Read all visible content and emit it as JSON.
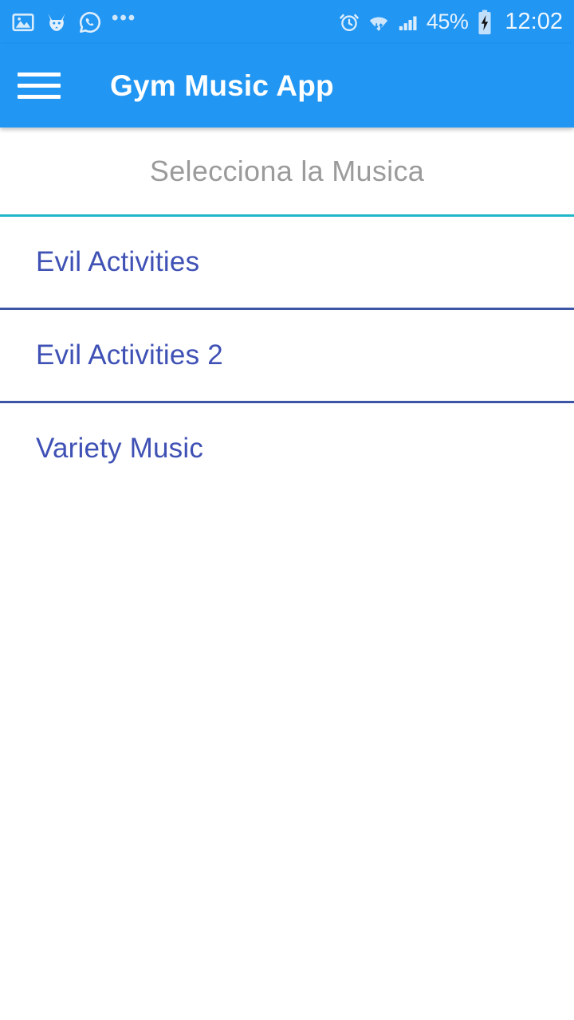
{
  "status_bar": {
    "background_color": "#2196f3",
    "left_icons": [
      {
        "name": "gallery-icon",
        "glyph": "image"
      },
      {
        "name": "fox-app-icon",
        "glyph": "fox"
      },
      {
        "name": "whatsapp-icon",
        "glyph": "whatsapp"
      }
    ],
    "overflow_dots": "•••",
    "right_icons": [
      {
        "name": "alarm-clock-icon",
        "glyph": "alarm"
      },
      {
        "name": "wifi-icon",
        "glyph": "wifi-transfer"
      },
      {
        "name": "cellular-signal-icon",
        "glyph": "signal-bars"
      }
    ],
    "battery_percent": "45%",
    "battery_state": "charging",
    "time": "12:02"
  },
  "app_bar": {
    "menu_label": "Menu",
    "title": "Gym Music App",
    "background_color": "#2196f3",
    "title_color": "#ffffff"
  },
  "section": {
    "title": "Selecciona la Musica",
    "title_color": "#9b9b9b",
    "divider_color": "#1fb6c9"
  },
  "music_list": {
    "item_color": "#3f51b5",
    "divider_color": "#3c55a5",
    "items": [
      {
        "label": "Evil Activities"
      },
      {
        "label": "Evil Activities 2"
      },
      {
        "label": "Variety Music"
      }
    ]
  }
}
